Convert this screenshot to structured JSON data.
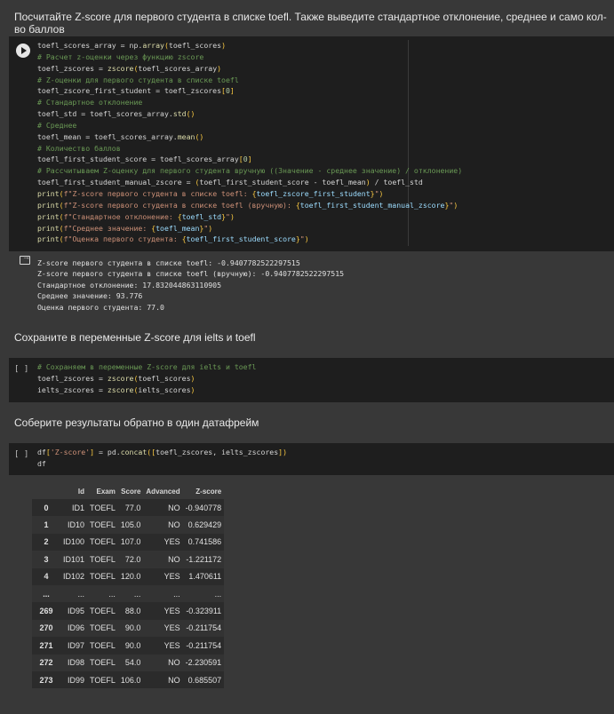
{
  "md1": "Посчитайте Z-score для первого студента в списке toefl. Также выведите стандартное отклонение, среднее и само кол-во баллов",
  "md2": "Сохраните в переменные Z-score для ielts и toefl",
  "md3": "Соберите результаты обратно в один датафрейм",
  "cell1": {
    "lines": [
      "toefl_scores_array = np.array(toefl_scores)",
      "# Расчет z-оценки через функцию zscore",
      "toefl_zscores = zscore(toefl_scores_array)",
      "# Z-оценки для первого студента в списке toefl",
      "toefl_zscore_first_student = toefl_zscores[0]",
      "# Стандартное отклонение",
      "toefl_std = toefl_scores_array.std()",
      "# Среднее",
      "toefl_mean = toefl_scores_array.mean()",
      "# Количество баллов",
      "toefl_first_student_score = toefl_scores_array[0]",
      "# Рассчитываем Z-оценку для первого студента вручную ((Значение - среднее значение) / отклонение)",
      "toefl_first_student_manual_zscore = (toefl_first_student_score - toefl_mean) / toefl_std",
      "print(f\"Z-score первого студента в списке toefl: {toefl_zscore_first_student}\")",
      "print(f\"Z-score первого студента в списке toefl (вручную): {toefl_first_student_manual_zscore}\")",
      "print(f\"Стандартное отклонение: {toefl_std}\")",
      "print(f\"Среднее значение: {toefl_mean}\")",
      "print(f\"Оценка первого студента: {toefl_first_student_score}\")"
    ],
    "output": [
      "Z-score первого студента в списке toefl: -0.9407782522297515",
      "Z-score первого студента в списке toefl (вручную): -0.9407782522297515",
      "Стандартное отклонение: 17.832044863110905",
      "Среднее значение: 93.776",
      "Оценка первого студента: 77.0"
    ]
  },
  "cell2": {
    "bracket": "[ ]",
    "lines": [
      "# Сохраняем в переменные Z-score для ielts и toefl",
      "toefl_zscores = zscore(toefl_scores)",
      "ielts_zscores = zscore(ielts_scores)"
    ]
  },
  "cell3": {
    "bracket": "[ ]",
    "lines": [
      "df['Z-score'] = pd.concat([toefl_zscores, ielts_zscores])",
      "df"
    ]
  },
  "table": {
    "columns": [
      "",
      "Id",
      "Exam",
      "Score",
      "Advanced",
      "Z-score"
    ],
    "rows": [
      [
        "0",
        "ID1",
        "TOEFL",
        "77.0",
        "NO",
        "-0.940778"
      ],
      [
        "1",
        "ID10",
        "TOEFL",
        "105.0",
        "NO",
        "0.629429"
      ],
      [
        "2",
        "ID100",
        "TOEFL",
        "107.0",
        "YES",
        "0.741586"
      ],
      [
        "3",
        "ID101",
        "TOEFL",
        "72.0",
        "NO",
        "-1.221172"
      ],
      [
        "4",
        "ID102",
        "TOEFL",
        "120.0",
        "YES",
        "1.470611"
      ],
      [
        "...",
        "...",
        "...",
        "...",
        "...",
        "..."
      ],
      [
        "269",
        "ID95",
        "TOEFL",
        "88.0",
        "YES",
        "-0.323911"
      ],
      [
        "270",
        "ID96",
        "TOEFL",
        "90.0",
        "YES",
        "-0.211754"
      ],
      [
        "271",
        "ID97",
        "TOEFL",
        "90.0",
        "YES",
        "-0.211754"
      ],
      [
        "272",
        "ID98",
        "TOEFL",
        "54.0",
        "NO",
        "-2.230591"
      ],
      [
        "273",
        "ID99",
        "TOEFL",
        "106.0",
        "NO",
        "0.685507"
      ]
    ]
  }
}
